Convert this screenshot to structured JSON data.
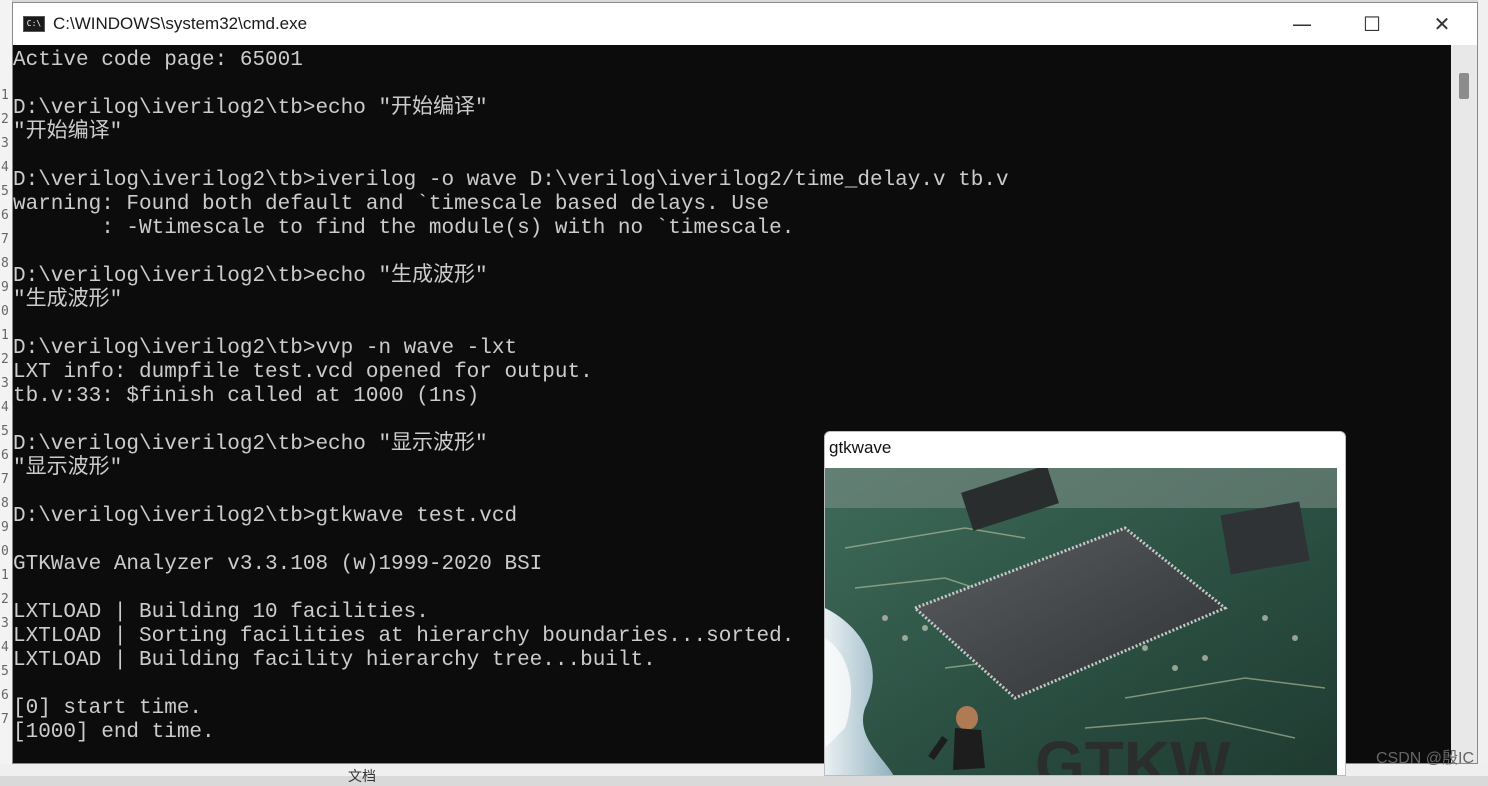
{
  "window": {
    "title": "C:\\WINDOWS\\system32\\cmd.exe",
    "controls": {
      "minimize": "—",
      "maximize": "☐",
      "close": "✕"
    }
  },
  "console": {
    "lines": [
      "Active code page: 65001",
      "",
      "D:\\verilog\\iverilog2\\tb>echo \"开始编译\"",
      "\"开始编译\"",
      "",
      "D:\\verilog\\iverilog2\\tb>iverilog -o wave D:\\verilog\\iverilog2/time_delay.v tb.v",
      "warning: Found both default and `timescale based delays. Use",
      "       : -Wtimescale to find the module(s) with no `timescale.",
      "",
      "D:\\verilog\\iverilog2\\tb>echo \"生成波形\"",
      "\"生成波形\"",
      "",
      "D:\\verilog\\iverilog2\\tb>vvp -n wave -lxt",
      "LXT info: dumpfile test.vcd opened for output.",
      "tb.v:33: $finish called at 1000 (1ns)",
      "",
      "D:\\verilog\\iverilog2\\tb>echo \"显示波形\"",
      "\"显示波形\"",
      "",
      "D:\\verilog\\iverilog2\\tb>gtkwave test.vcd",
      "",
      "GTKWave Analyzer v3.3.108 (w)1999-2020 BSI",
      "",
      "LXTLOAD | Building 10 facilities.",
      "LXTLOAD | Sorting facilities at hierarchy boundaries...sorted.",
      "LXTLOAD | Building facility hierarchy tree...built.",
      "",
      "[0] start time.",
      "[1000] end time."
    ]
  },
  "gtkwave": {
    "title": "gtkwave",
    "logo_text": "GTKW"
  },
  "background": {
    "folder_label": "文档",
    "line_numbers": [
      "1",
      "2",
      "3",
      "4",
      "5",
      "6",
      "7",
      "8",
      "9",
      "0",
      "1",
      "2",
      "3",
      "4",
      "5",
      "6",
      "7",
      "8",
      "9",
      "0",
      "1",
      "2",
      "3",
      "4",
      "5",
      "6",
      "7"
    ]
  },
  "watermark": "CSDN @殷IC",
  "colors": {
    "console_bg": "#0c0c0c",
    "console_fg": "#cccccc",
    "titlebar_bg": "#ffffff"
  }
}
